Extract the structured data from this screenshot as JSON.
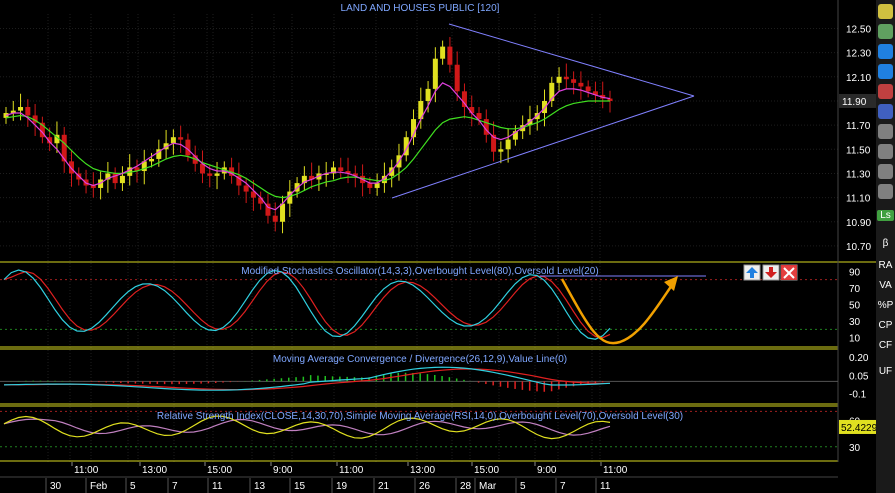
{
  "title": "LAND AND HOUSES PUBLIC [120]",
  "colors": {
    "up": "#e0e020",
    "down": "#d01818",
    "ma_fast": "#e040e0",
    "ma_slow": "#40e020",
    "triangle": "#8080ff",
    "grid": "#1e1e1e",
    "axis_text": "#ffffff",
    "panel_border": "#d8d820",
    "arrow": "#f0a000"
  },
  "price_panel": {
    "y_ticks": [
      "12.50",
      "12.30",
      "12.10",
      "11.90",
      "11.70",
      "11.50",
      "11.30",
      "11.10",
      "10.90",
      "10.70"
    ],
    "last_price": "11.90"
  },
  "stochastic_panel": {
    "label": "Modified Stochastics Oscillator(14,3,3),Overbought Level(80),Oversold Level(20)",
    "y_ticks": [
      "90",
      "70",
      "50",
      "30",
      "10"
    ],
    "buttons": [
      "move-up",
      "move-down",
      "close"
    ]
  },
  "macd_panel": {
    "label": "Moving Average Convergence / Divergence(26,12,9),Value Line(0)",
    "y_ticks": [
      "0.20",
      "0.05",
      "-0.1"
    ]
  },
  "rsi_panel": {
    "label": "Relative Strength Index(CLOSE,14,30,70),Simple Moving Average(RSI,14,0),Overbought Level(70),Oversold Level(30)",
    "y_ticks": [
      "60",
      "30"
    ],
    "last_value": "52.4229"
  },
  "time_axis": {
    "times": [
      "11:00",
      "13:00",
      "15:00",
      "11",
      "9:00",
      "11:00",
      "13:00",
      "15:00",
      "9:00",
      "11:00"
    ],
    "dates": [
      "30",
      "Feb",
      "5",
      "7",
      "11",
      "13",
      "15",
      "19",
      "21",
      "26",
      "28",
      "Mar",
      "5",
      "7",
      "11"
    ]
  },
  "toolbar": {
    "icons": [
      "arrow-icon",
      "edit-icon",
      "zoom-in-icon",
      "zoom-out-icon",
      "drawing-icon",
      "cursor-icon",
      "magnify-icon",
      "magnify-plus-icon",
      "magnify-minus-icon",
      "chart-icon"
    ],
    "labels": [
      "Ls",
      "β",
      "RA",
      "VA",
      "%P",
      "CP",
      "CF",
      "UF"
    ]
  },
  "chart_data": {
    "type": "candlestick",
    "title": "LAND AND HOUSES PUBLIC [120]",
    "ylim": [
      10.6,
      12.62
    ],
    "close_approx": [
      11.8,
      11.82,
      11.85,
      11.78,
      11.72,
      11.6,
      11.55,
      11.62,
      11.4,
      11.3,
      11.25,
      11.2,
      11.18,
      11.25,
      11.3,
      11.22,
      11.28,
      11.35,
      11.32,
      11.4,
      11.42,
      11.5,
      11.55,
      11.6,
      11.58,
      11.45,
      11.38,
      11.3,
      11.28,
      11.3,
      11.35,
      11.28,
      11.2,
      11.15,
      11.1,
      11.05,
      10.95,
      10.9,
      11.05,
      11.15,
      11.22,
      11.28,
      11.25,
      11.3,
      11.3,
      11.35,
      11.32,
      11.3,
      11.28,
      11.22,
      11.18,
      11.22,
      11.28,
      11.35,
      11.45,
      11.6,
      11.75,
      11.9,
      12.0,
      12.25,
      12.35,
      12.2,
      11.98,
      11.85,
      11.8,
      11.75,
      11.62,
      11.48,
      11.5,
      11.58,
      11.65,
      11.7,
      11.75,
      11.8,
      11.9,
      12.05,
      12.1,
      12.08,
      12.05,
      12.02,
      11.98,
      11.95,
      11.92,
      11.9
    ],
    "ma_fast_approx": [
      11.78,
      11.8,
      11.8,
      11.76,
      11.7,
      11.64,
      11.56,
      11.5,
      11.42,
      11.34,
      11.28,
      11.22,
      11.2,
      11.22,
      11.26,
      11.28,
      11.3,
      11.33,
      11.36,
      11.4,
      11.44,
      11.48,
      11.52,
      11.55,
      11.54,
      11.5,
      11.44,
      11.38,
      11.34,
      11.32,
      11.32,
      11.3,
      11.26,
      11.22,
      11.16,
      11.1,
      11.02,
      11.0,
      11.05,
      11.12,
      11.18,
      11.23,
      11.25,
      11.28,
      11.3,
      11.31,
      11.31,
      11.3,
      11.28,
      11.25,
      11.22,
      11.22,
      11.26,
      11.32,
      11.4,
      11.5,
      11.62,
      11.75,
      11.86,
      11.98,
      12.05,
      12.02,
      11.95,
      11.88,
      11.8,
      11.74,
      11.66,
      11.6,
      11.58,
      11.6,
      11.64,
      11.68,
      11.73,
      11.78,
      11.84,
      11.92,
      11.98,
      12.0,
      12.0,
      11.99,
      11.97,
      11.95,
      11.93,
      11.92
    ],
    "ma_slow_approx": [
      11.76,
      11.77,
      11.78,
      11.77,
      11.74,
      11.7,
      11.65,
      11.6,
      11.55,
      11.49,
      11.43,
      11.38,
      11.34,
      11.32,
      11.31,
      11.3,
      11.3,
      11.31,
      11.32,
      11.34,
      11.36,
      11.39,
      11.42,
      11.44,
      11.45,
      11.44,
      11.42,
      11.39,
      11.37,
      11.35,
      11.33,
      11.31,
      11.29,
      11.26,
      11.22,
      11.18,
      11.14,
      11.11,
      11.1,
      11.11,
      11.13,
      11.16,
      11.19,
      11.21,
      11.23,
      11.24,
      11.26,
      11.27,
      11.27,
      11.26,
      11.25,
      11.24,
      11.24,
      11.26,
      11.3,
      11.35,
      11.42,
      11.5,
      11.58,
      11.66,
      11.72,
      11.75,
      11.76,
      11.77,
      11.76,
      11.74,
      11.72,
      11.7,
      11.68,
      11.67,
      11.67,
      11.68,
      11.7,
      11.72,
      11.75,
      11.79,
      11.83,
      11.86,
      11.88,
      11.89,
      11.9,
      11.9,
      11.9,
      11.9
    ],
    "triangle_lines": [
      {
        "from": [
          11.12,
          "pt0"
        ],
        "to": [
          11.9,
          "apex"
        ]
      },
      {
        "from": [
          12.52,
          "pt1"
        ],
        "to": [
          11.9,
          "apex"
        ]
      }
    ]
  }
}
